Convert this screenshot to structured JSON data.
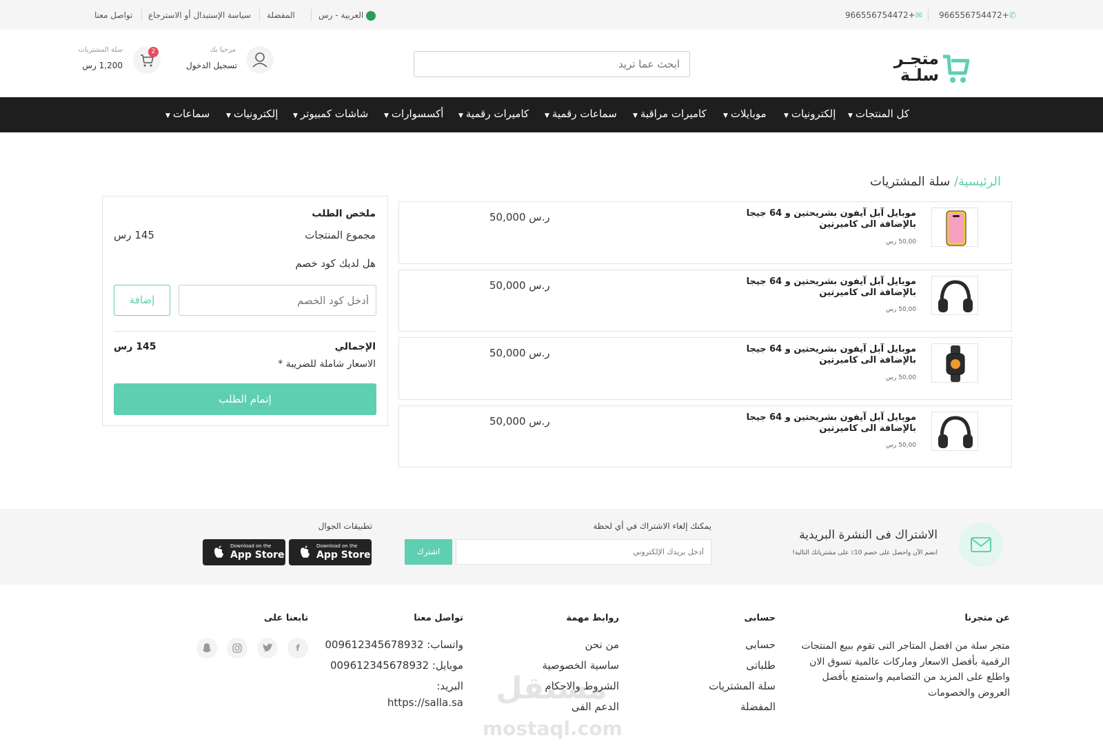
{
  "topbar": {
    "phone_1": "966556754472+",
    "phone_2": "966556754472+",
    "language": "العربية - رس",
    "favorites": "المفضلة",
    "policy": "سياسة الإستبدال أو الاسترجاع",
    "contact": "تواصل معنا",
    "flag_text": "السعودية"
  },
  "header": {
    "logo_line1": "متجـر",
    "logo_line2": "سلـة",
    "search_placeholder": "ابحث عما تريد",
    "welcome": "مرحبا بك",
    "login": "تسجيل الدخول",
    "cart_label": "سلة المشتريات",
    "cart_total": "1,200 رس",
    "cart_badge": "2"
  },
  "nav": {
    "items": [
      "كل المنتجات",
      "إلكترونيات",
      "موبايلات",
      "كاميرات مراقبة",
      "سماعات رقمية",
      "كاميرات رقمية",
      "أكسسوارات",
      "شاشات كمبيوتر",
      "إلكترونيات",
      "سماعات"
    ]
  },
  "breadcrumb": {
    "home": "الرئيسية/",
    "current": " سلة المشتريات"
  },
  "products": [
    {
      "title_line1": "موبايل آبل آيفون بشريحتين و 64 جيجا",
      "title_line2": "بالإضافة الى كاميرتين",
      "unit_price": "50,00 رس",
      "price": "50,000 ر.س",
      "image": "yellow-phone"
    },
    {
      "title_line1": "موبايل آبل آيفون بشريحتين و 64 جيجا",
      "title_line2": "بالإضافة الى كاميرتين",
      "unit_price": "50,00 رس",
      "price": "50,000 ر.س",
      "image": "headphones"
    },
    {
      "title_line1": "موبايل آبل آيفون بشريحتين و 64 جيجا",
      "title_line2": "بالإضافة الى كاميرتين",
      "unit_price": "50,00 رس",
      "price": "50,000 ر.س",
      "image": "smartwatch"
    },
    {
      "title_line1": "موبايل آبل آيفون بشريحتين و 64 جيجا",
      "title_line2": "بالإضافة الى كاميرتين",
      "unit_price": "50,00 رس",
      "price": "50,000 ر.س",
      "image": "headphones"
    }
  ],
  "summary": {
    "title": "ملخص الطلب",
    "subtotal_label": "مجموع المنتجات",
    "subtotal_value": "145 رس",
    "coupon_question": "هل لديك كود خصم",
    "coupon_placeholder": "أدخل كود الخصم",
    "add_label": "إضافة",
    "total_label": "الإجمالي",
    "total_value": "145 رس",
    "tax_note": "الاسعار شاملة للضريبة *",
    "checkout_label": "إتمام الطلب"
  },
  "newsletter": {
    "title": "الاشتراك فى النشرة البريدية",
    "subtitle": "انضم الآن واحصل على خصم 10٪ على مشترياتك التالية!",
    "cancel_note": "يمكنك إلغاء الاشتراك في أي لحظة",
    "email_placeholder": "أدخل بريدك الإلكتروني",
    "subscribe_label": "اشترك",
    "apps_title": "تطبيقات الجوال",
    "app_small": "Download on the",
    "app_big": "App Store"
  },
  "footer": {
    "about_title": "عن متجرنا",
    "about_lines": [
      "متجر سلة من افضل المتاجر التى تقوم ببيع المنتجات",
      "الرقمية بأفضل الاسعار وماركات عالمية تسوق الان",
      "واطلع على المزيد من التصاميم واستمتع بأفضل",
      "العروض والخصومات"
    ],
    "account_title": "حسابى",
    "account_links": [
      "حسابى",
      "طلباتى",
      "سلة المشتريات",
      "المفضلة"
    ],
    "links_title": "روابط مهمة",
    "links": [
      "من نحن",
      "ساسية الخصوصية",
      "الشروط والاحكام",
      "الدعم الفى"
    ],
    "contact_title": "تواصل معنا",
    "whatsapp": "واتساب: 009612345678932",
    "mobile": "موبايل: 009612345678932",
    "email_label": "البريد:",
    "email_value": "https://salla.sa",
    "follow_title": "تابعنا على",
    "social": [
      "facebook-icon",
      "twitter-icon",
      "instagram-icon",
      "snapchat-icon"
    ],
    "watermark_ar": "مستقل",
    "watermark_en": "mostaql.com"
  },
  "colors": {
    "accent": "#5ecfb1",
    "nav_bg": "#1e1e1e",
    "badge": "#e84c5a"
  }
}
